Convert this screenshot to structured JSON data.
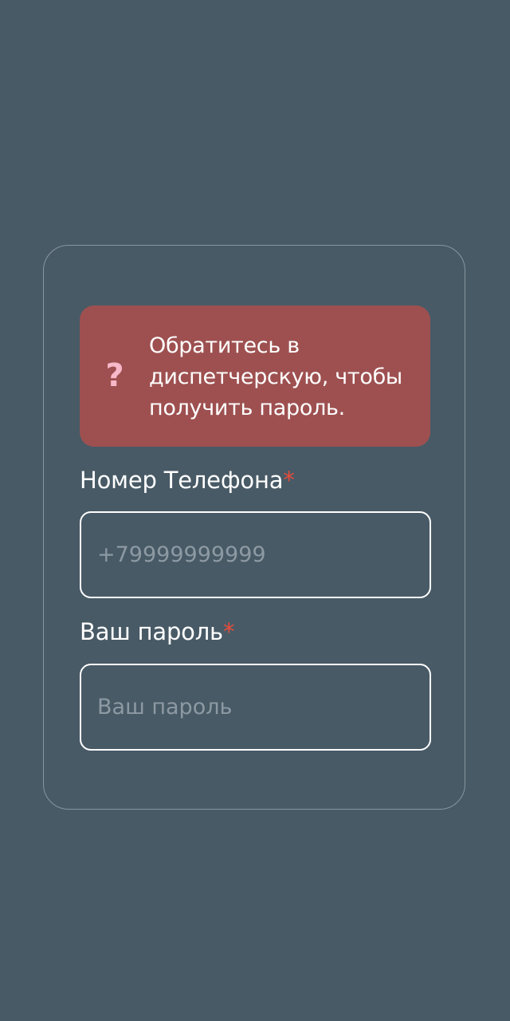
{
  "alert": {
    "icon": "question-mark-icon",
    "icon_glyph": "?",
    "message": "Обратитесь в диспетчерскую, чтобы получить пароль."
  },
  "form": {
    "phone": {
      "label": "Номер Телефона",
      "required_mark": "*",
      "placeholder": "+79999999999",
      "value": ""
    },
    "password": {
      "label": "Ваш пароль",
      "required_mark": "*",
      "placeholder": "Ваш пароль",
      "value": ""
    }
  },
  "colors": {
    "background": "#485a66",
    "card_border": "#8796a0",
    "alert_background": "#9e5050",
    "alert_icon": "#f7b8c9",
    "required_mark": "#e74c3c",
    "text": "#ffffff",
    "placeholder": "#8d9aa3"
  }
}
